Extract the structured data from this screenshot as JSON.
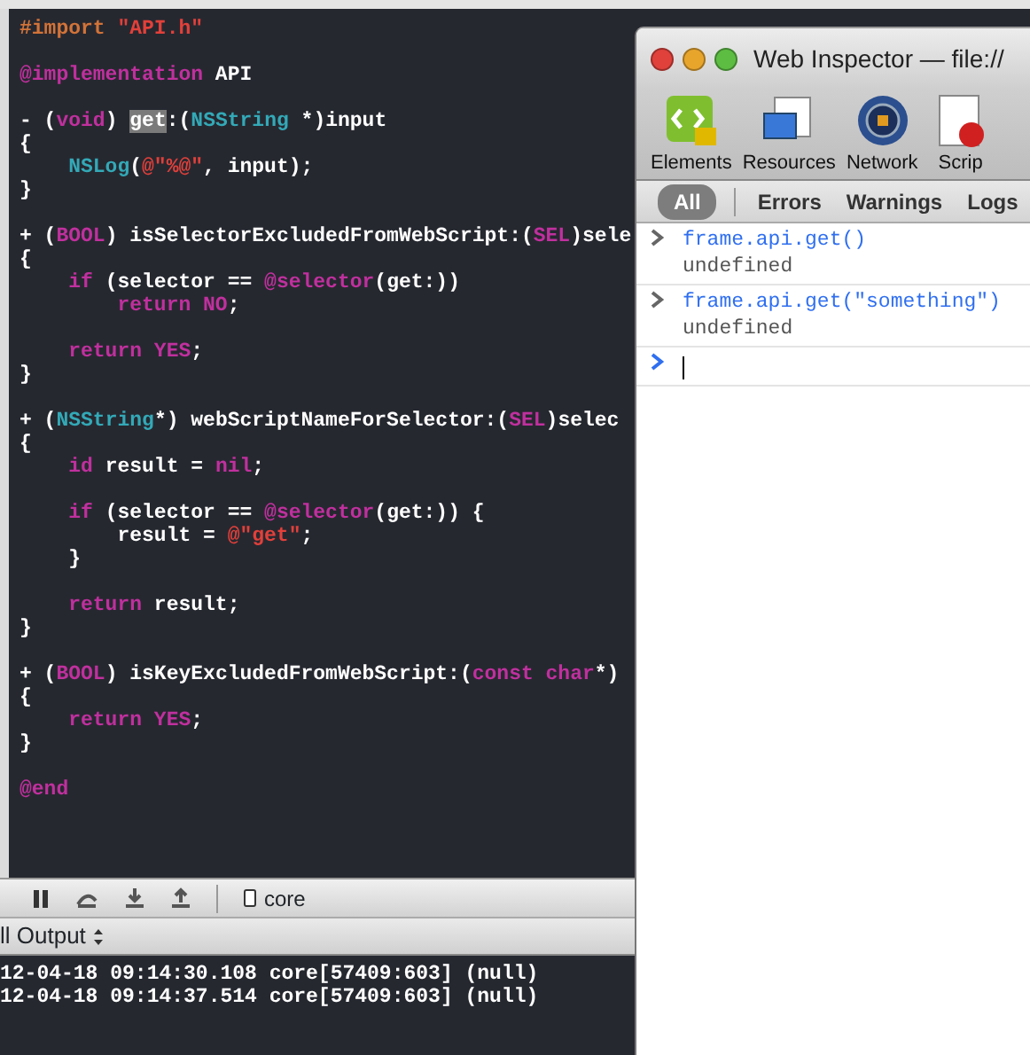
{
  "editor": {
    "lines": [
      {
        "kind": "code",
        "tokens": [
          {
            "kind": "preproc",
            "text": "#import "
          },
          {
            "kind": "string",
            "text": "\"API.h\""
          }
        ]
      },
      {
        "kind": "blank"
      },
      {
        "kind": "code",
        "tokens": [
          {
            "kind": "keyword",
            "text": "@implementation"
          },
          {
            "kind": "plain",
            "text": " API"
          }
        ]
      },
      {
        "kind": "blank"
      },
      {
        "kind": "code",
        "tokens": [
          {
            "kind": "plain",
            "text": "- ("
          },
          {
            "kind": "keyword",
            "text": "void"
          },
          {
            "kind": "plain",
            "text": ") "
          },
          {
            "kind": "selection",
            "text": "get"
          },
          {
            "kind": "plain",
            "text": ":("
          },
          {
            "kind": "type",
            "text": "NSString"
          },
          {
            "kind": "plain",
            "text": " *)input"
          }
        ]
      },
      {
        "kind": "code",
        "tokens": [
          {
            "kind": "plain",
            "text": "{"
          }
        ]
      },
      {
        "kind": "code",
        "tokens": [
          {
            "kind": "type",
            "text": "    NSLog"
          },
          {
            "kind": "plain",
            "text": "("
          },
          {
            "kind": "string",
            "text": "@\"%@\""
          },
          {
            "kind": "plain",
            "text": ", input);"
          }
        ]
      },
      {
        "kind": "code",
        "tokens": [
          {
            "kind": "plain",
            "text": "}"
          }
        ]
      },
      {
        "kind": "blank"
      },
      {
        "kind": "code",
        "tokens": [
          {
            "kind": "plain",
            "text": "+ ("
          },
          {
            "kind": "keyword",
            "text": "BOOL"
          },
          {
            "kind": "plain",
            "text": ") isSelectorExcludedFromWebScript:("
          },
          {
            "kind": "keyword",
            "text": "SEL"
          },
          {
            "kind": "plain",
            "text": ")sele"
          }
        ]
      },
      {
        "kind": "code",
        "tokens": [
          {
            "kind": "plain",
            "text": "{"
          }
        ]
      },
      {
        "kind": "code",
        "tokens": [
          {
            "kind": "keyword",
            "text": "    if"
          },
          {
            "kind": "plain",
            "text": " (selector == "
          },
          {
            "kind": "keyword",
            "text": "@selector"
          },
          {
            "kind": "plain",
            "text": "(get:))"
          }
        ]
      },
      {
        "kind": "code",
        "tokens": [
          {
            "kind": "keyword",
            "text": "        return NO"
          },
          {
            "kind": "plain",
            "text": ";"
          }
        ]
      },
      {
        "kind": "blank"
      },
      {
        "kind": "code",
        "tokens": [
          {
            "kind": "keyword",
            "text": "    return YES"
          },
          {
            "kind": "plain",
            "text": ";"
          }
        ]
      },
      {
        "kind": "code",
        "tokens": [
          {
            "kind": "plain",
            "text": "}"
          }
        ]
      },
      {
        "kind": "blank"
      },
      {
        "kind": "code",
        "tokens": [
          {
            "kind": "plain",
            "text": "+ ("
          },
          {
            "kind": "type",
            "text": "NSString"
          },
          {
            "kind": "plain",
            "text": "*) webScriptNameForSelector:("
          },
          {
            "kind": "keyword",
            "text": "SEL"
          },
          {
            "kind": "plain",
            "text": ")selec"
          }
        ]
      },
      {
        "kind": "code",
        "tokens": [
          {
            "kind": "plain",
            "text": "{"
          }
        ]
      },
      {
        "kind": "code",
        "tokens": [
          {
            "kind": "keyword",
            "text": "    id"
          },
          {
            "kind": "plain",
            "text": " result = "
          },
          {
            "kind": "keyword",
            "text": "nil"
          },
          {
            "kind": "plain",
            "text": ";"
          }
        ]
      },
      {
        "kind": "blank"
      },
      {
        "kind": "code",
        "tokens": [
          {
            "kind": "keyword",
            "text": "    if"
          },
          {
            "kind": "plain",
            "text": " (selector == "
          },
          {
            "kind": "keyword",
            "text": "@selector"
          },
          {
            "kind": "plain",
            "text": "(get:)) {"
          }
        ]
      },
      {
        "kind": "code",
        "tokens": [
          {
            "kind": "plain",
            "text": "        result = "
          },
          {
            "kind": "string",
            "text": "@\"get\""
          },
          {
            "kind": "plain",
            "text": ";"
          }
        ]
      },
      {
        "kind": "code",
        "tokens": [
          {
            "kind": "plain",
            "text": "    }"
          }
        ]
      },
      {
        "kind": "blank"
      },
      {
        "kind": "code",
        "tokens": [
          {
            "kind": "keyword",
            "text": "    return"
          },
          {
            "kind": "plain",
            "text": " result;"
          }
        ]
      },
      {
        "kind": "code",
        "tokens": [
          {
            "kind": "plain",
            "text": "}"
          }
        ]
      },
      {
        "kind": "blank"
      },
      {
        "kind": "code",
        "tokens": [
          {
            "kind": "plain",
            "text": "+ ("
          },
          {
            "kind": "keyword",
            "text": "BOOL"
          },
          {
            "kind": "plain",
            "text": ") isKeyExcludedFromWebScript:("
          },
          {
            "kind": "keyword",
            "text": "const char"
          },
          {
            "kind": "plain",
            "text": "*)"
          }
        ]
      },
      {
        "kind": "code",
        "tokens": [
          {
            "kind": "plain",
            "text": "{"
          }
        ]
      },
      {
        "kind": "code",
        "tokens": [
          {
            "kind": "keyword",
            "text": "    return YES"
          },
          {
            "kind": "plain",
            "text": ";"
          }
        ]
      },
      {
        "kind": "code",
        "tokens": [
          {
            "kind": "plain",
            "text": "}"
          }
        ]
      },
      {
        "kind": "blank"
      },
      {
        "kind": "code",
        "tokens": [
          {
            "kind": "keyword",
            "text": "@end"
          }
        ]
      }
    ]
  },
  "debug_bar": {
    "target": "core"
  },
  "output": {
    "selector": "ll Output",
    "lines": [
      "12-04-18 09:14:30.108 core[57409:603] (null)",
      "12-04-18 09:14:37.514 core[57409:603] (null)"
    ]
  },
  "inspector": {
    "title": "Web Inspector — file://",
    "toolbar": [
      {
        "kind": "elements",
        "label": "Elements"
      },
      {
        "kind": "resources",
        "label": "Resources"
      },
      {
        "kind": "network",
        "label": "Network"
      },
      {
        "kind": "scripts",
        "label": "Scrip"
      }
    ],
    "filters": [
      {
        "label": "All",
        "selected": true
      },
      {
        "label": "Errors",
        "selected": false
      },
      {
        "label": "Warnings",
        "selected": false
      },
      {
        "label": "Logs",
        "selected": false
      }
    ],
    "console": [
      {
        "command": "frame.api.get()",
        "result": "undefined"
      },
      {
        "command": "frame.api.get(\"something\")",
        "result": "undefined"
      }
    ]
  }
}
